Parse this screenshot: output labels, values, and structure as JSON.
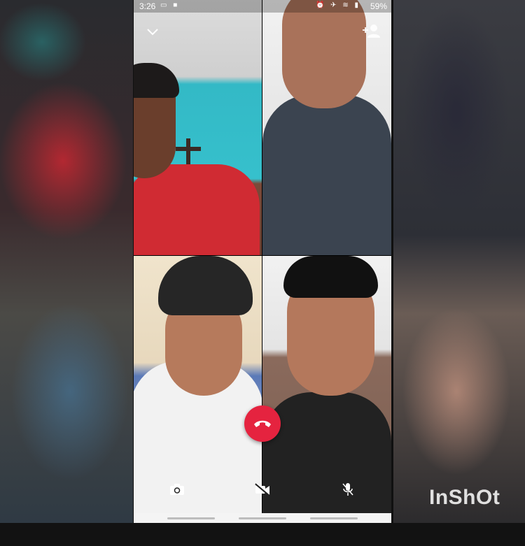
{
  "status_bar": {
    "time": "3:26",
    "battery": "59%"
  },
  "icons": {
    "collapse": "chevron-down-icon",
    "add_participant": "add-person-icon",
    "end_call": "phone-hangup-icon",
    "switch_camera": "camera-switch-icon",
    "video_off": "video-off-icon",
    "mute": "mic-off-icon"
  },
  "colors": {
    "end_call": "#e5233f"
  },
  "watermark": "InShOt"
}
